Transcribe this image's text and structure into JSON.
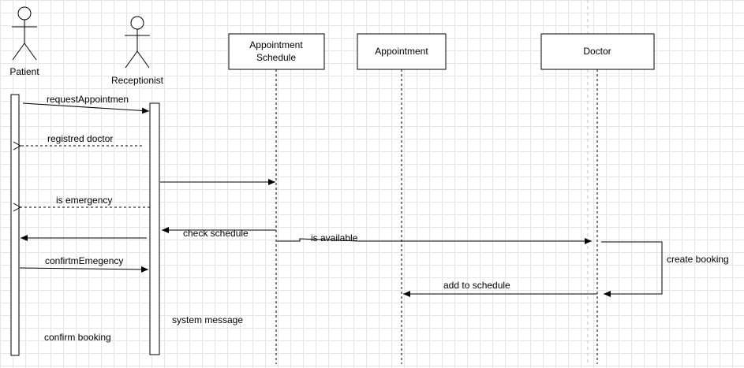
{
  "actors": {
    "patient": "Patient",
    "receptionist": "Receptionist"
  },
  "objects": {
    "schedule_line1": "Appointment",
    "schedule_line2": "Schedule",
    "appointment": "Appointment",
    "doctor": "Doctor"
  },
  "messages": {
    "request": "requestAppointmen",
    "registered": "registred doctor",
    "emergency": "is emergency",
    "check": "check schedule",
    "available": "is available",
    "confirm_emergency": "confirtmEmegency",
    "create": "create booking",
    "add": "add to schedule"
  },
  "notes": {
    "system": "system message",
    "confirm": "confirm booking"
  }
}
